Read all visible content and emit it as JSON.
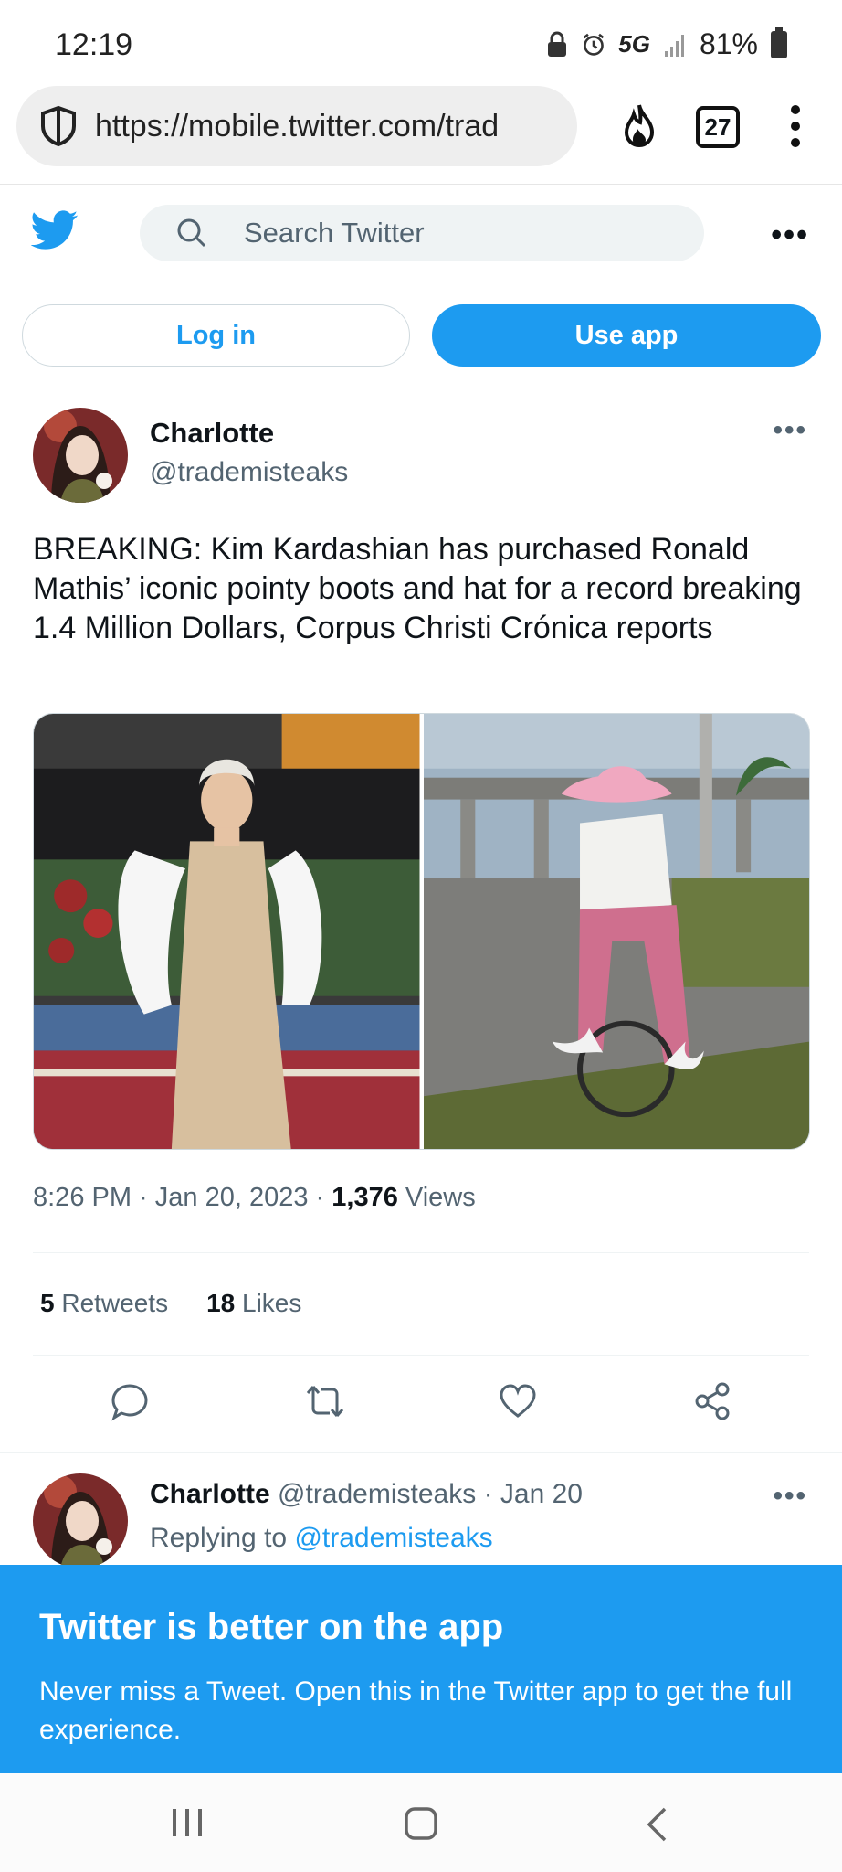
{
  "status": {
    "time": "12:19",
    "network": "5G",
    "battery": "81%"
  },
  "browser": {
    "url": "https://mobile.twitter.com/trad",
    "tab_count": "27"
  },
  "header": {
    "search_placeholder": "Search Twitter",
    "more": "•••"
  },
  "auth": {
    "login_label": "Log in",
    "use_app_label": "Use app"
  },
  "tweet": {
    "author_name": "Charlotte",
    "author_handle": "@trademisteaks",
    "text": "BREAKING: Kim Kardashian has purchased Ronald Mathis’ iconic pointy boots and hat for a record breaking 1.4 Million Dollars, Corpus Christi Crónica reports",
    "time": "8:26 PM",
    "date": "Jan 20, 2023",
    "views_count": "1,376",
    "views_label": "Views",
    "retweets_count": "5",
    "retweets_label": "Retweets",
    "likes_count": "18",
    "likes_label": "Likes"
  },
  "reply": {
    "author_name": "Charlotte",
    "author_handle": "@trademisteaks",
    "date": "· Jan 20",
    "replying_prefix": "Replying to",
    "replying_to": "@trademisteaks"
  },
  "banner": {
    "title": "Twitter is better on the app",
    "text": "Never miss a Tweet. Open this in the Twitter app to get the full experience."
  },
  "colors": {
    "brand": "#1d9bf0",
    "text": "#0f1419",
    "secondary": "#536471"
  }
}
